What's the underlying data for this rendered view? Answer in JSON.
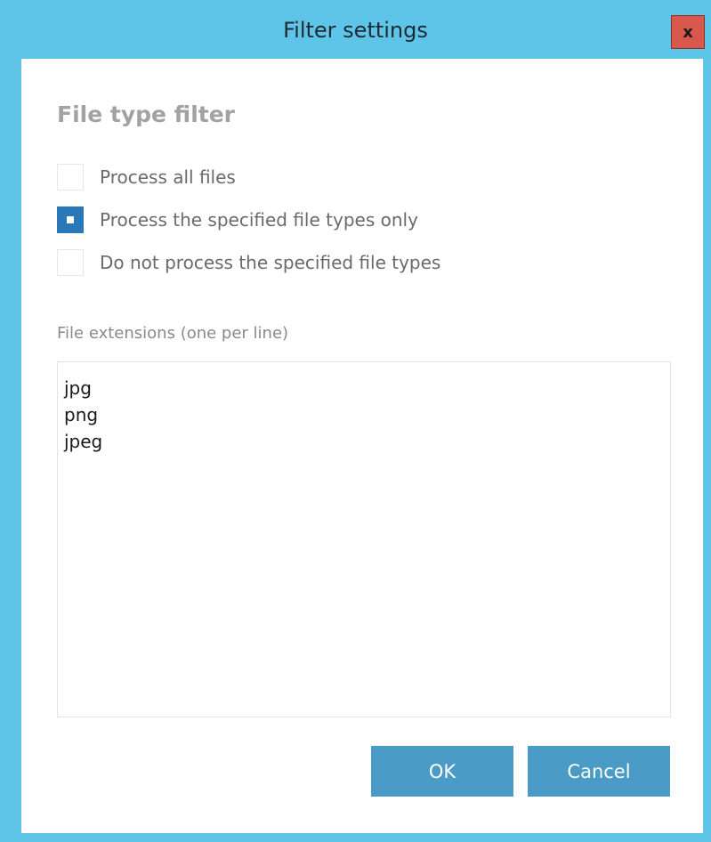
{
  "window": {
    "title": "Filter settings",
    "close_label": "x"
  },
  "filter": {
    "section_title": "File type filter",
    "options": [
      {
        "label": "Process all files",
        "checked": false
      },
      {
        "label": "Process the specified file types only",
        "checked": true
      },
      {
        "label": "Do not process the specified file types",
        "checked": false
      }
    ]
  },
  "extensions": {
    "label": "File extensions (one per line)",
    "lines": [
      "jpg",
      "png",
      "jpeg"
    ]
  },
  "buttons": {
    "ok_label": "OK",
    "cancel_label": "Cancel"
  },
  "colors": {
    "titlebar": "#5ec5e8",
    "accent": "#2b78b8",
    "button": "#4a9cc7",
    "close": "#d9584c"
  }
}
